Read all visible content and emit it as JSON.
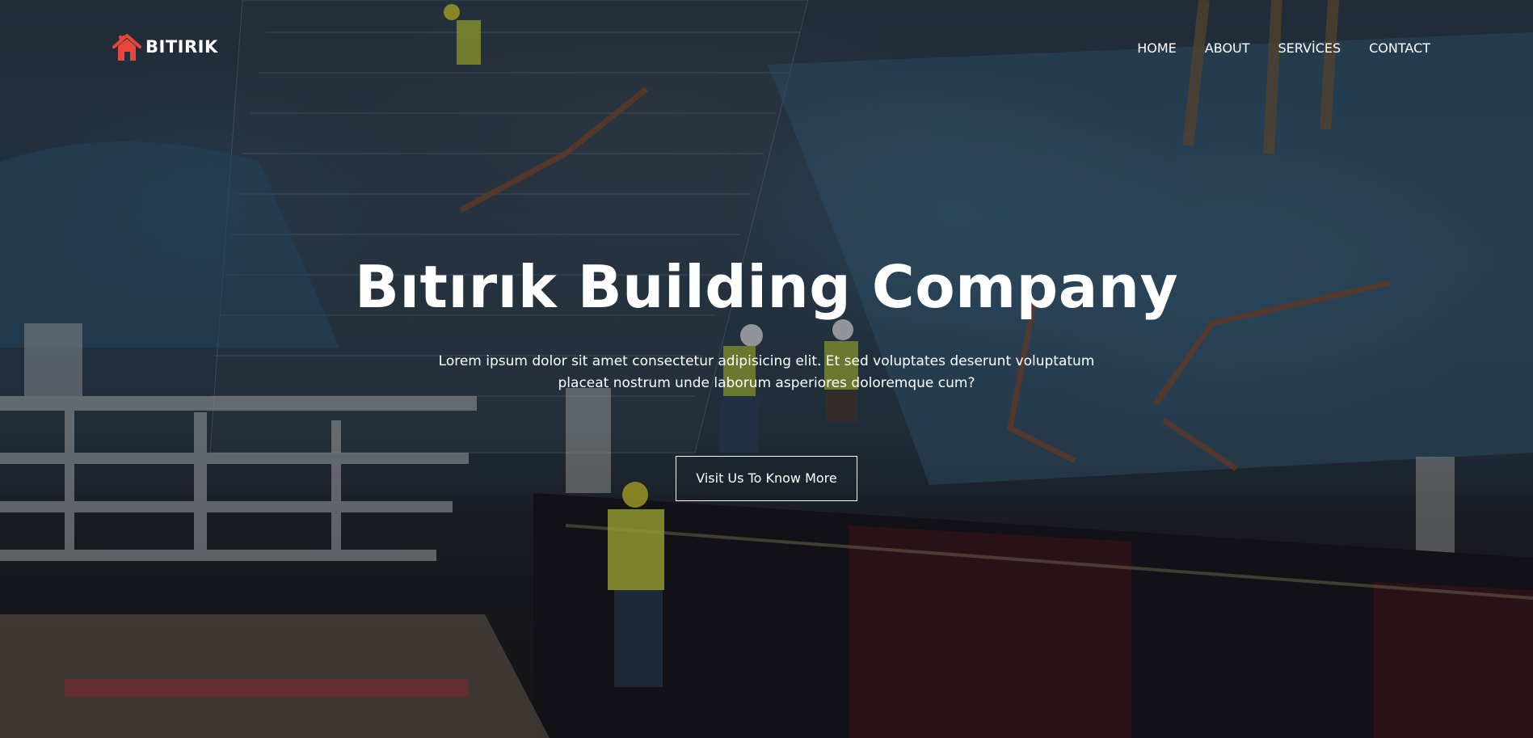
{
  "brand": {
    "name": "BITIRIK",
    "accent": "#e8453c"
  },
  "nav": {
    "items": [
      {
        "label": "HOME"
      },
      {
        "label": "ABOUT"
      },
      {
        "label": "SERVİCES"
      },
      {
        "label": "CONTACT"
      }
    ]
  },
  "hero": {
    "title": "Bıtırık Building Company",
    "description": "Lorem ipsum dolor sit amet consectetur adipisicing elit. Et sed voluptates deserunt voluptatum placeat nostrum unde laborum asperiores doloremque cum?",
    "cta_label": "Visit Us To Know More",
    "background": "construction-site-photo"
  }
}
